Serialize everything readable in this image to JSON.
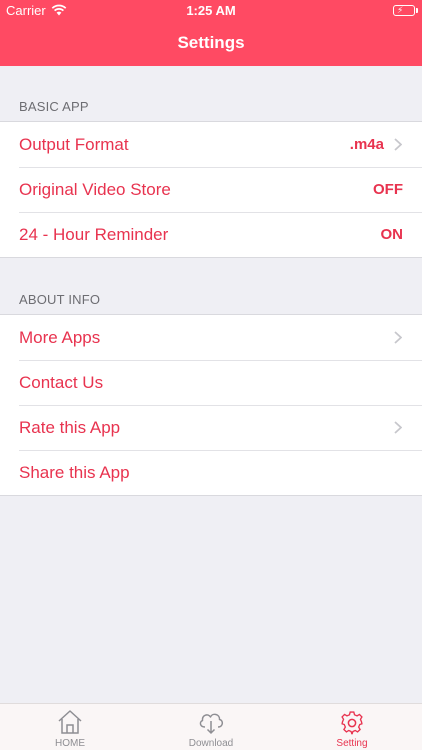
{
  "status_bar": {
    "carrier": "Carrier",
    "time": "1:25 AM"
  },
  "nav": {
    "title": "Settings"
  },
  "sections": {
    "basic": {
      "header": "BASIC APP",
      "rows": [
        {
          "label": "Output Format",
          "value": ".m4a"
        },
        {
          "label": "Original Video Store",
          "value": "OFF"
        },
        {
          "label": "24 - Hour Reminder",
          "value": "ON"
        }
      ]
    },
    "about": {
      "header": "ABOUT INFO",
      "rows": [
        {
          "label": "More Apps"
        },
        {
          "label": "Contact Us"
        },
        {
          "label": "Rate this App"
        },
        {
          "label": "Share this App"
        }
      ]
    }
  },
  "tab_bar": {
    "tabs": [
      {
        "label": "HOME",
        "icon": "home-icon"
      },
      {
        "label": "Download",
        "icon": "cloud-download-icon"
      },
      {
        "label": "Setting",
        "icon": "gear-icon",
        "active": true
      }
    ]
  },
  "colors": {
    "accent": "#ff4a63",
    "text_accent": "#e8334f",
    "background": "#efeff4"
  }
}
